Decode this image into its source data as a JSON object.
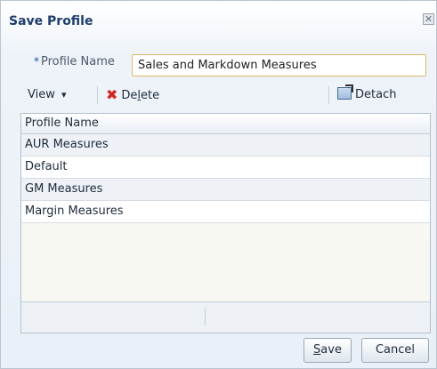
{
  "dialog": {
    "title": "Save Profile",
    "close_glyph": "✕"
  },
  "form": {
    "required_marker": "*",
    "profile_name_label": "Profile Name",
    "profile_name_value": "Sales and Markdown Measures"
  },
  "toolbar": {
    "view_label": "View",
    "view_caret": "▾",
    "delete_label_pre": "De",
    "delete_label_ul": "l",
    "delete_label_post": "ete",
    "detach_label": "Detach"
  },
  "table": {
    "header": "Profile Name",
    "rows": [
      "AUR Measures",
      "Default",
      "GM Measures",
      "Margin Measures"
    ]
  },
  "buttons": {
    "save_ul": "S",
    "save_rest": "ave",
    "cancel": "Cancel"
  }
}
